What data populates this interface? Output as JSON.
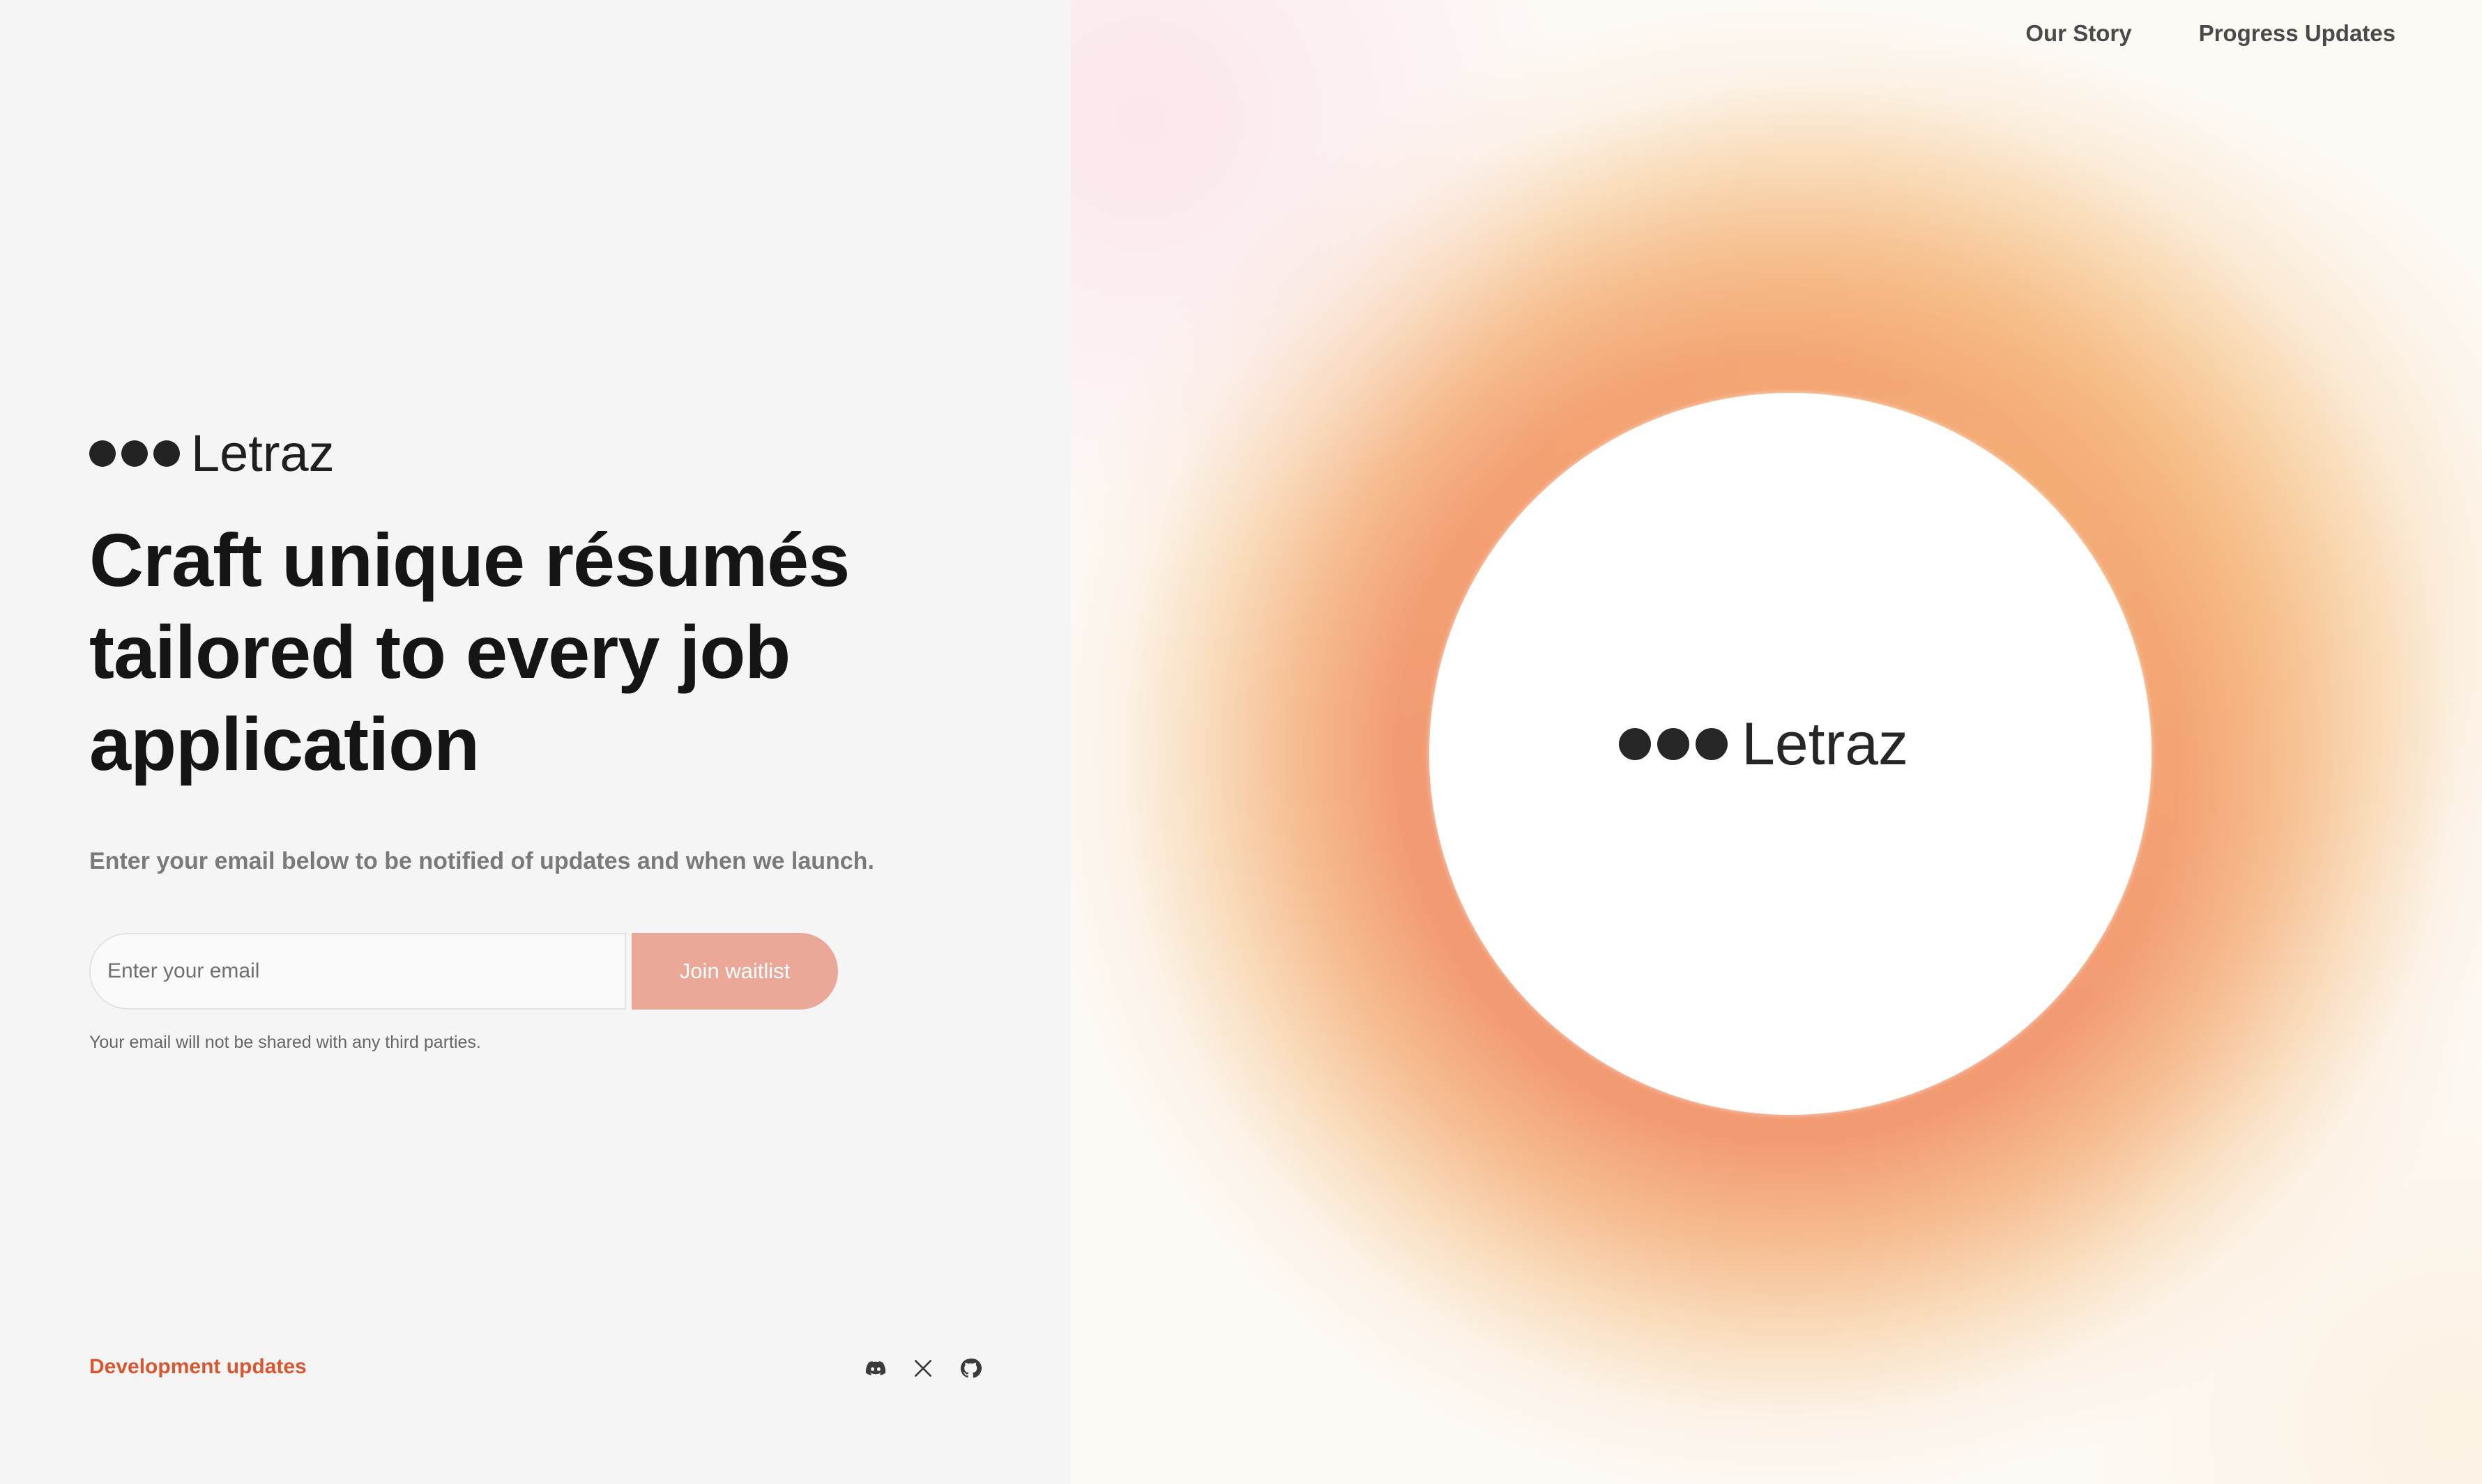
{
  "brand": {
    "name": "Letraz"
  },
  "hero": {
    "headline": "Craft unique résumés tailored to every job application",
    "subtitle": "Enter your email below to be notified of updates and when we launch."
  },
  "signup": {
    "email_placeholder": "Enter your email",
    "email_value": "",
    "button_label": "Join waitlist",
    "privacy_note": "Your email will not be shared with any third parties."
  },
  "footer": {
    "dev_updates_label": "Development updates",
    "socials": [
      {
        "icon": "discord-icon"
      },
      {
        "icon": "x-icon"
      },
      {
        "icon": "github-icon"
      }
    ]
  },
  "nav": {
    "items": [
      {
        "label": "Our Story"
      },
      {
        "label": "Progress Updates"
      }
    ]
  },
  "colors": {
    "accent": "#d8572f",
    "button": "#eba898",
    "text_dark": "#151515",
    "glow_orange": "#f08c66"
  }
}
